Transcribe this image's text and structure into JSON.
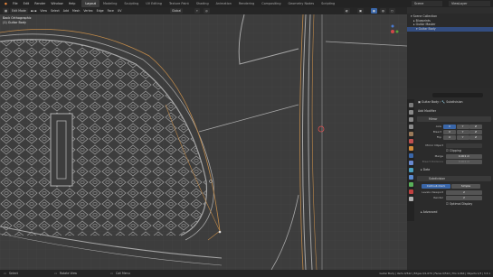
{
  "topbar": {
    "menus": [
      "File",
      "Edit",
      "Render",
      "Window",
      "Help"
    ],
    "workspaces": [
      "Layout",
      "Modeling",
      "Sculpting",
      "UV Editing",
      "Texture Paint",
      "Shading",
      "Animation",
      "Rendering",
      "Compositing",
      "Geometry Nodes",
      "Scripting"
    ],
    "active_workspace": "Layout",
    "scene_label": "Scene",
    "view_layer_label": "ViewLayer"
  },
  "viewport_header": {
    "mode": "Edit Mode",
    "menus": [
      "View",
      "Select",
      "Add",
      "Mesh",
      "Vertex",
      "Edge",
      "Face",
      "UV"
    ],
    "transform": "Global"
  },
  "viewport": {
    "view_name": "Back Orthographic",
    "object_info": "(1) Guitar Body"
  },
  "outliner": {
    "title": "Scene Collection",
    "items": [
      "Blueprints",
      "Guitar Master",
      "Guitar Body"
    ]
  },
  "properties": {
    "object": "Guitar Body",
    "modifier_tab": "Subdivision",
    "add_modifier": "Add Modifier",
    "mirror": {
      "name": "Mirror",
      "axis_label": "Axis",
      "bisect_label": "Bisect",
      "flip_label": "Flip",
      "axes": [
        "X",
        "Y",
        "Z"
      ],
      "mirror_object_label": "Mirror Object",
      "clipping_label": "Clipping",
      "merge_label": "Merge",
      "merge_value": "0.001 m",
      "bisect_distance_label": "Bisect Distance",
      "bisect_distance_value": "0.001 m",
      "data_label": "Data"
    },
    "subdivision": {
      "name": "Subdivision",
      "type_catmull": "Catmull-Clark",
      "type_simple": "Simple",
      "levels_viewport_label": "Levels Viewport",
      "levels_viewport": "2",
      "render_label": "Render",
      "render": "2",
      "optimal_display_label": "Optimal Display",
      "advanced_label": "Advanced"
    }
  },
  "statusbar": {
    "select": "Select",
    "rotate": "Rotate View",
    "menu": "Call Menu",
    "stats": "Guitar Body | Verts 0/542 | Edges 0/1,070 | Faces 0/512 | Tris 1,064 | Objects 1/3 | 3.3.1"
  },
  "colors": {
    "accent": "#3a66a8",
    "wire": "#a7a7a7",
    "outline": "#c08a4a",
    "background": "#3d3d3d"
  }
}
